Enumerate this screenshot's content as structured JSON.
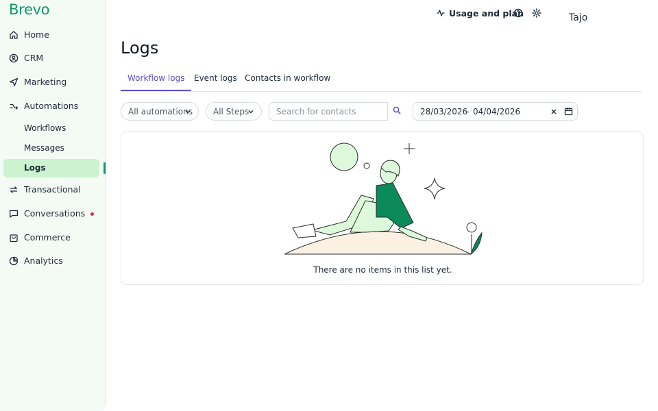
{
  "brand": {
    "logo": "Brevo",
    "accent": "#0b996e",
    "link_color": "#5b4fc9"
  },
  "sidebar": {
    "items": [
      {
        "label": "Home",
        "icon": "home-icon"
      },
      {
        "label": "CRM",
        "icon": "contacts-icon"
      },
      {
        "label": "Marketing",
        "icon": "send-icon"
      },
      {
        "label": "Automations",
        "icon": "automation-icon"
      },
      {
        "label": "Transactional",
        "icon": "transactional-icon"
      },
      {
        "label": "Conversations",
        "icon": "chat-icon"
      },
      {
        "label": "Commerce",
        "icon": "shopping-bag-icon"
      },
      {
        "label": "Analytics",
        "icon": "analytics-icon"
      }
    ],
    "sub_items": [
      {
        "label": "Workflows"
      },
      {
        "label": "Messages"
      },
      {
        "label": "Logs",
        "active": true
      }
    ]
  },
  "header": {
    "usage_label": "Usage and plan",
    "user_name": "Tajo"
  },
  "page": {
    "title": "Logs",
    "tabs": [
      {
        "label": "Workflow logs",
        "active": true
      },
      {
        "label": "Event logs"
      },
      {
        "label": "Contacts in workflow"
      }
    ]
  },
  "filters": {
    "automations": "All automations",
    "steps": "All Steps",
    "search_placeholder": "Search for contacts",
    "date_from": "28/03/2026",
    "date_separator": "-",
    "date_to": "04/04/2026"
  },
  "empty_state": {
    "message": "There are no items in this list yet."
  }
}
